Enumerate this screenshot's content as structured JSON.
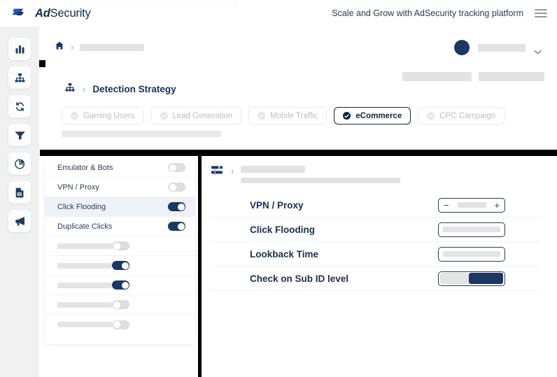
{
  "header": {
    "brand_bold": "Ad",
    "brand_light": "Security",
    "tagline": "Scale and Grow with AdSecurity tracking platform",
    "logo_icon": "adsecurity-s-logo",
    "menu_icon": "hamburger-menu-icon"
  },
  "rail": {
    "items": [
      {
        "icon": "bar-chart-icon",
        "name": "analytics"
      },
      {
        "icon": "sitemap-icon",
        "name": "detection-strategy"
      },
      {
        "icon": "sync-icon",
        "name": "sync"
      },
      {
        "icon": "funnel-icon",
        "name": "filters"
      },
      {
        "icon": "pie-chart-icon",
        "name": "reports"
      },
      {
        "icon": "calendar-doc-icon",
        "name": "schedules"
      },
      {
        "icon": "megaphone-icon",
        "name": "campaigns"
      }
    ]
  },
  "breadcrumb": {
    "home_icon": "home-icon",
    "separator": "›",
    "placeholder_width": 92
  },
  "user": {
    "avatar_icon": "avatar",
    "caret_icon": "chevron-down-icon"
  },
  "page": {
    "icon": "sitemap-icon",
    "separator": "›",
    "title": "Detection Strategy"
  },
  "chips": [
    {
      "label": "Gaming Users",
      "active": false,
      "icon": "check-circle-icon"
    },
    {
      "label": "Lead Generation",
      "active": false,
      "icon": "check-circle-icon"
    },
    {
      "label": "Mobile Traffic",
      "active": false,
      "icon": "check-circle-icon"
    },
    {
      "label": "eCommerce",
      "active": true,
      "icon": "check-circle-icon"
    },
    {
      "label": "CPC Campaign",
      "active": false,
      "icon": "check-circle-icon"
    }
  ],
  "rule_list": {
    "rows": [
      {
        "label": "Emulator & Bots",
        "placeholder": false,
        "toggle": "off",
        "selected": false
      },
      {
        "label": "VPN / Proxy",
        "placeholder": false,
        "toggle": "off",
        "selected": false
      },
      {
        "label": "Click Flooding",
        "placeholder": false,
        "toggle": "on",
        "selected": true
      },
      {
        "label": "Duplicate Clicks",
        "placeholder": false,
        "toggle": "on",
        "selected": false
      },
      {
        "label": "",
        "placeholder": true,
        "toggle": "off",
        "selected": false
      },
      {
        "label": "",
        "placeholder": true,
        "toggle": "on",
        "selected": false
      },
      {
        "label": "",
        "placeholder": true,
        "toggle": "on",
        "selected": false
      },
      {
        "label": "",
        "placeholder": true,
        "toggle": "off",
        "selected": false
      },
      {
        "label": "",
        "placeholder": true,
        "toggle": "off",
        "selected": false
      }
    ]
  },
  "detail": {
    "icon": "sliders-icon",
    "separator": "›",
    "rows": [
      {
        "label": "VPN / Proxy",
        "control": "stepper",
        "minus": "−",
        "plus": "+"
      },
      {
        "label": "Click Flooding",
        "control": "field"
      },
      {
        "label": "Lookback Time",
        "control": "field"
      },
      {
        "label": "Check on Sub ID level",
        "control": "segmented"
      }
    ]
  },
  "colors": {
    "navy": "#1d3763",
    "ink": "#1c2f4e",
    "rail_bg": "#f0f0f0",
    "selected_row": "#eef1f8",
    "skeleton": "#e3e3e5"
  }
}
